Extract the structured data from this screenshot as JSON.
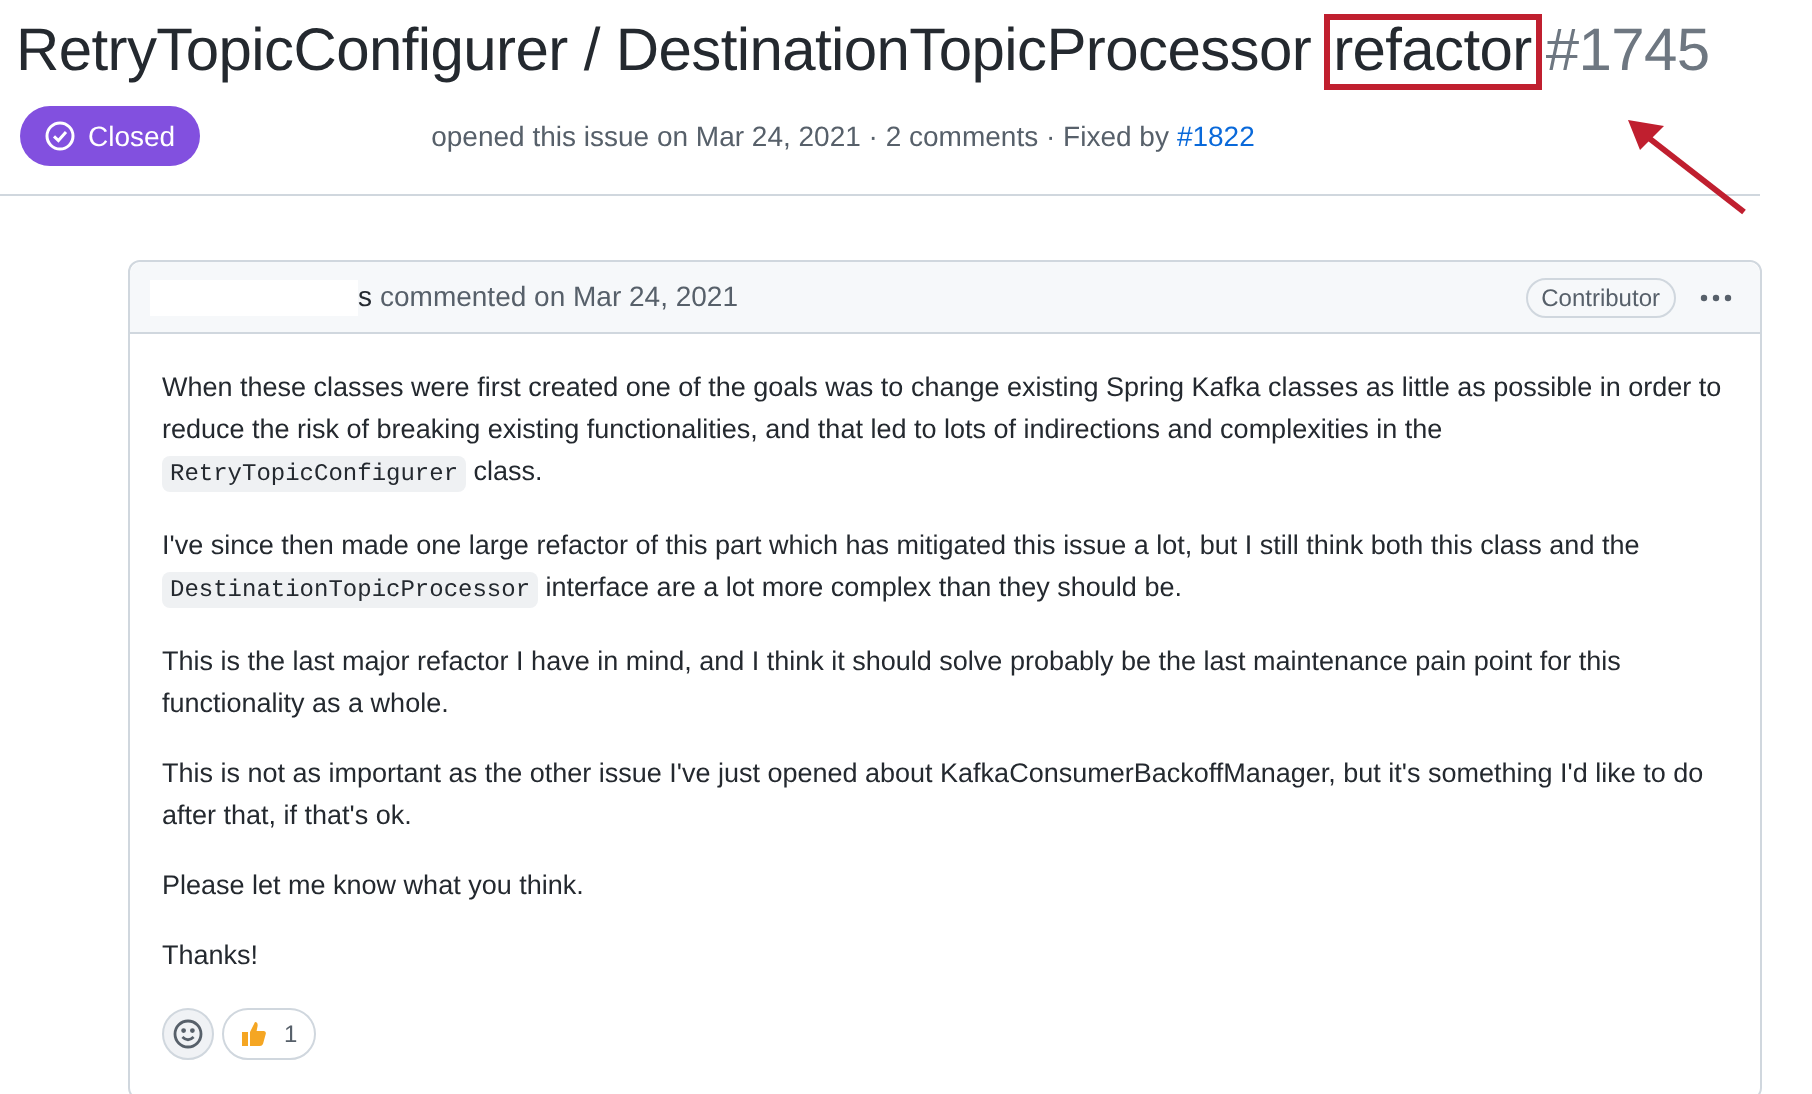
{
  "issue": {
    "title": "RetryTopicConfigurer / DestinationTopicProcessor",
    "highlighted_word": "refactor",
    "number": "#1745",
    "state": {
      "label": "Closed",
      "kind": "closed"
    },
    "meta": "opened this issue on Mar 24, 2021 · 2 comments · Fixed by",
    "fixed_by": "#1822"
  },
  "comment": {
    "author": "s",
    "action": "commented on Mar 24, 2021",
    "badge": "Contributor",
    "paragraphs": [
      [
        {
          "kind": "text",
          "text": "When these classes were first created one of the goals was to change existing Spring Kafka classes as little as possible in order to reduce the risk of breaking existing functionalities, and that led to lots of indirections and complexities in the "
        },
        {
          "kind": "code",
          "text": "RetryTopicConfigurer"
        },
        {
          "kind": "text",
          "text": " class."
        }
      ],
      [
        {
          "kind": "text",
          "text": "I've since then made one large refactor of this part which has mitigated this issue a lot, but I still think both this class and the "
        },
        {
          "kind": "code",
          "text": "DestinationTopicProcessor"
        },
        {
          "kind": "text",
          "text": " interface are a lot more complex than they should be."
        }
      ],
      [
        {
          "kind": "text",
          "text": "This is the last major refactor I have in mind, and I think it should solve probably be the last maintenance pain point for this functionality as a whole."
        }
      ],
      [
        {
          "kind": "text",
          "text": "This is not as important as the other issue I've just opened about KafkaConsumerBackoffManager, but it's something I'd like to do after that, if that's ok."
        }
      ],
      [
        {
          "kind": "text",
          "text": "Please let me know what you think."
        }
      ],
      [
        {
          "kind": "text",
          "text": "Thanks!"
        }
      ]
    ],
    "reactions": [
      {
        "kind": "thumbs-up",
        "count": "1"
      }
    ]
  }
}
